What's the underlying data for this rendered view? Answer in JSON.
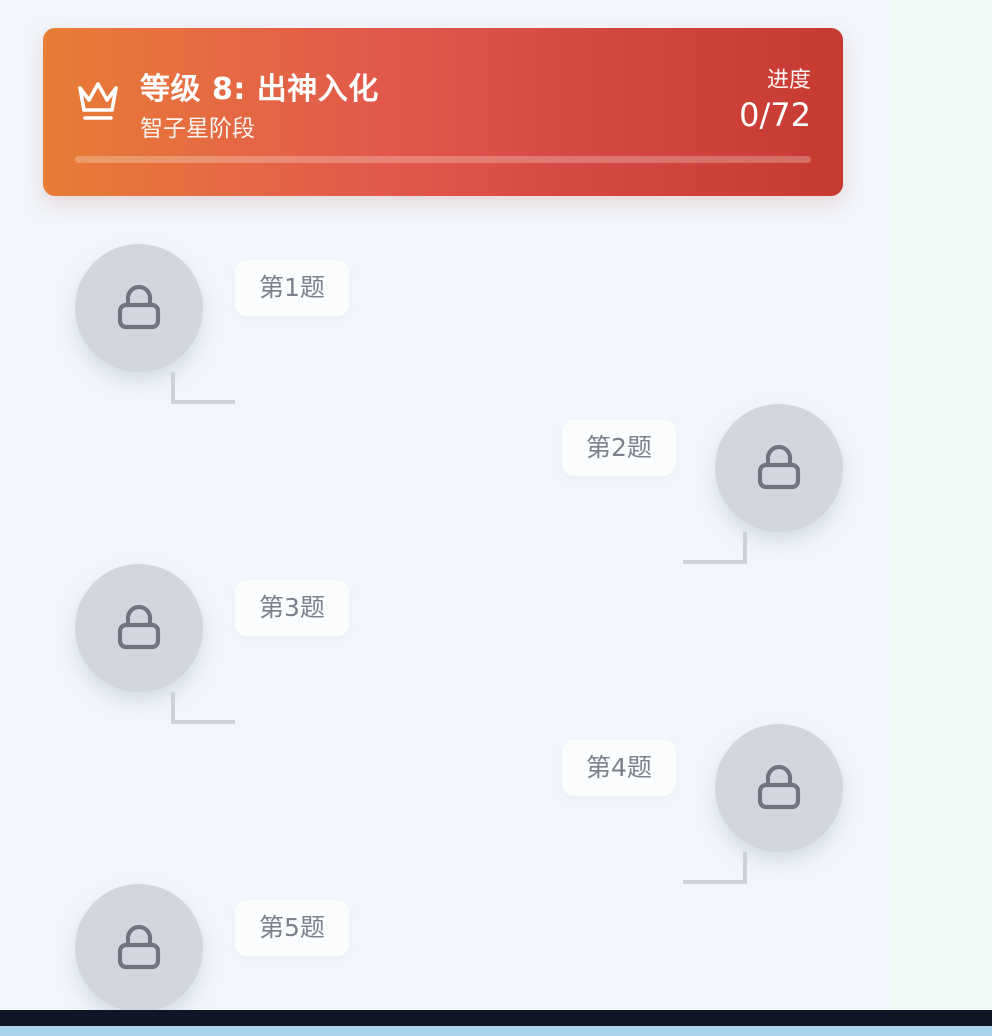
{
  "level_card": {
    "title": "等级 8: 出神入化",
    "subtitle": "智子星阶段",
    "progress_label": "进度",
    "progress_value": "0/72",
    "progress_fraction": 0,
    "crown_icon": "crown-icon"
  },
  "questions": [
    {
      "label": "第1题",
      "locked": true
    },
    {
      "label": "第2题",
      "locked": true
    },
    {
      "label": "第3题",
      "locked": true
    },
    {
      "label": "第4题",
      "locked": true
    },
    {
      "label": "第5题",
      "locked": true
    }
  ],
  "colors": {
    "card_gradient_start": "#e87d36",
    "card_gradient_end": "#c63a32",
    "node_locked": "#d2d6de",
    "lock_icon": "#6f7480",
    "background": "#f2f6fc"
  }
}
